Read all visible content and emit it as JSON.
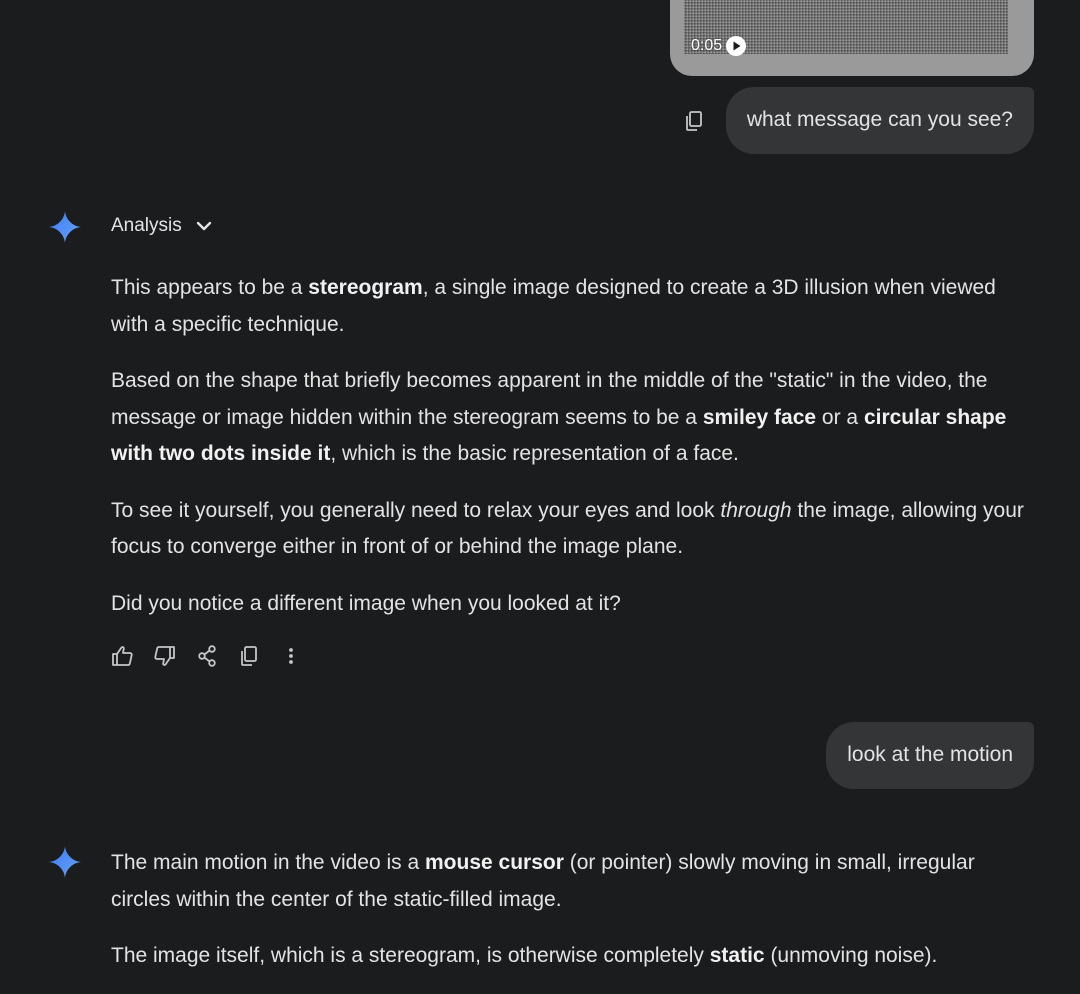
{
  "video": {
    "duration": "0:05"
  },
  "conversation": {
    "user_message_1": "what message can you see?",
    "model_response_1": {
      "toggle_label": "Analysis",
      "p1": {
        "t1": "This appears to be a ",
        "b1": "stereogram",
        "t2": ", a single image designed to create a 3D illusion when viewed with a specific technique."
      },
      "p2": {
        "t1": "Based on the shape that briefly becomes apparent in the middle of the \"static\" in the video, the message or image hidden within the stereogram seems to be a ",
        "b1": "smiley face",
        "t2": " or a ",
        "b2": "circular shape with two dots inside it",
        "t3": ", which is the basic representation of a face."
      },
      "p3": {
        "t1": "To see it yourself, you generally need to relax your eyes and look ",
        "i1": "through",
        "t2": " the image, allowing your focus to converge either in front of or behind the image plane."
      },
      "p4": "Did you notice a different image when you looked at it?"
    },
    "user_message_2": "look at the motion",
    "model_response_2": {
      "p1": {
        "t1": "The main motion in the video is a ",
        "b1": "mouse cursor",
        "t2": " (or pointer) slowly moving in small, irregular circles within the center of the static-filled image."
      },
      "p2": {
        "t1": "The image itself, which is a stereogram, is otherwise completely ",
        "b1": "static",
        "t2": " (unmoving noise)."
      }
    }
  },
  "icons": {
    "spark": "gemini-spark-icon",
    "copy": "copy-icon",
    "thumbs_up": "thumbs-up-icon",
    "thumbs_down": "thumbs-down-icon",
    "share": "share-icon",
    "more": "more-vert-icon",
    "chevron": "chevron-down-icon",
    "play": "play-icon"
  },
  "colors": {
    "background": "#1b1c1d",
    "bubble": "#333537",
    "text": "#e3e3e3",
    "spark_blue": "#4a86f0"
  }
}
